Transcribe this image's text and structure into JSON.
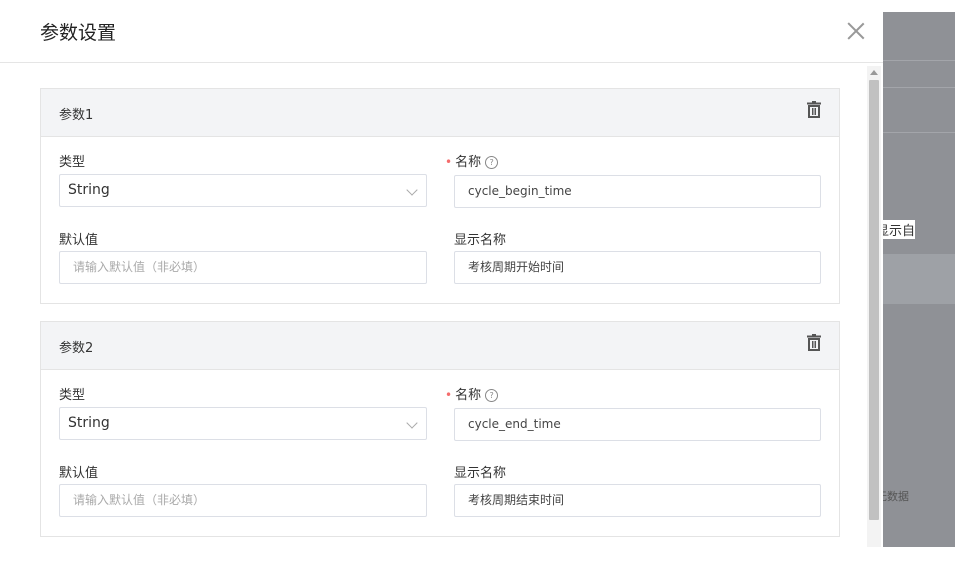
{
  "dialog": {
    "title": "参数设置"
  },
  "background": {
    "text1": "显示自",
    "text2": "无数据"
  },
  "params": [
    {
      "title": "参数1",
      "type_label": "类型",
      "type_value": "String",
      "name_label": "名称",
      "name_value": "cycle_begin_time",
      "default_label": "默认值",
      "default_placeholder": "请输入默认值（非必填）",
      "display_label": "显示名称",
      "display_value": "考核周期开始时间"
    },
    {
      "title": "参数2",
      "type_label": "类型",
      "type_value": "String",
      "name_label": "名称",
      "name_value": "cycle_end_time",
      "default_label": "默认值",
      "default_placeholder": "请输入默认值（非必填）",
      "display_label": "显示名称",
      "display_value": "考核周期结束时间"
    }
  ],
  "icons": {
    "close": "close-icon",
    "delete": "trash-icon",
    "help": "question-circle-icon",
    "dropdown": "chevron-down-icon"
  },
  "colors": {
    "required": "#f56c6c",
    "card_header": "#f3f4f6",
    "border": "#dcdfe6"
  }
}
